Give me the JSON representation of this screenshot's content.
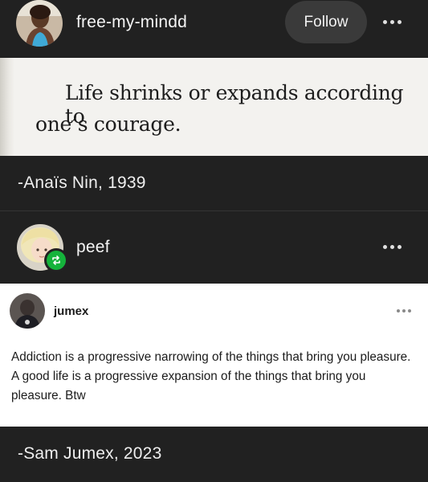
{
  "post1": {
    "username": "free-my-mindd",
    "follow_label": "Follow",
    "more_icon": "more-dots-icon",
    "quote_image": {
      "line1": "Life shrinks or expands according to",
      "line2": "one’s courage."
    },
    "caption": "-Anaïs Nin, 1939"
  },
  "post2": {
    "username": "peef",
    "reblog_icon": "reblog-icon",
    "reblog_color": "#15b33b",
    "more_icon": "more-dots-icon",
    "embedded": {
      "username": "jumex",
      "text": "Addiction is a progressive narrowing of the things that bring you pleasure. A good life is a progressive expansion of the things that bring you pleasure. Btw"
    },
    "caption": "-Sam Jumex, 2023"
  }
}
